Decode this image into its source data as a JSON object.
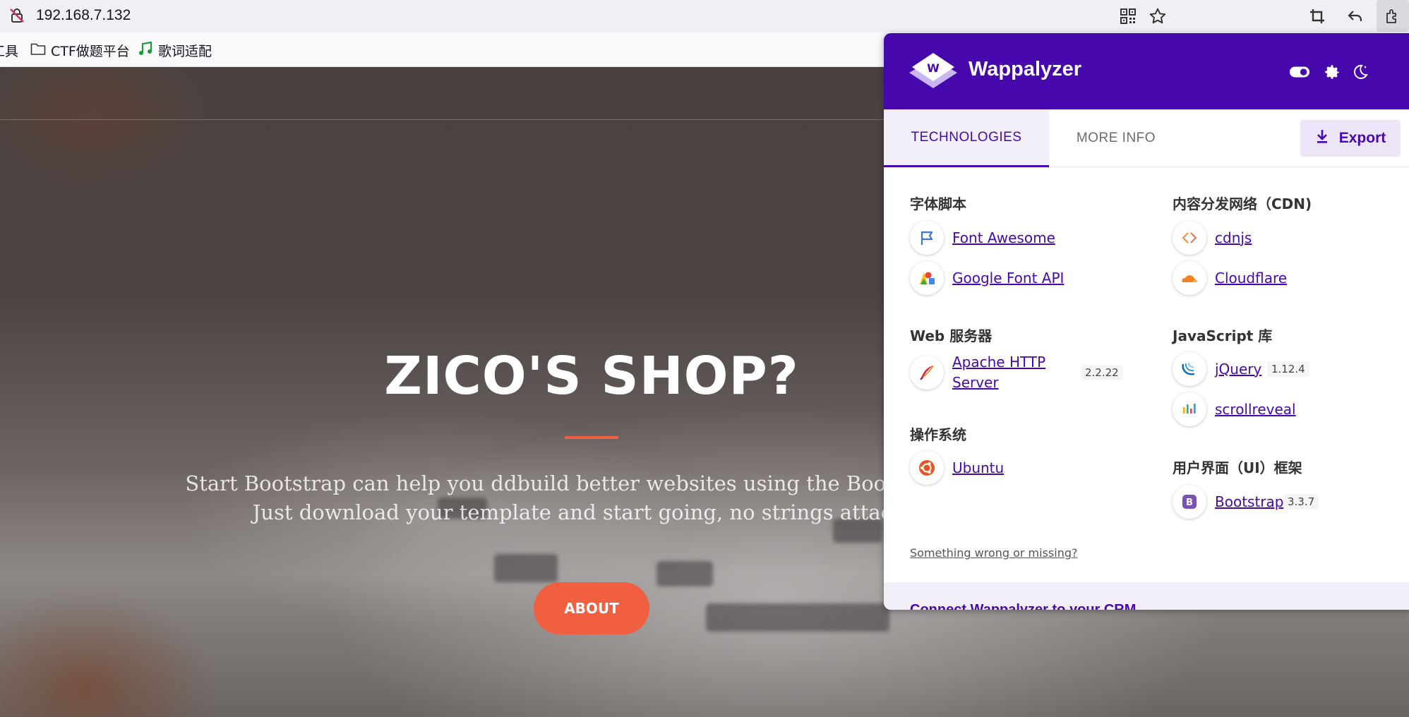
{
  "browser": {
    "url": "192.168.7.132",
    "bookmarks": [
      {
        "label": "工具",
        "icon": "partial-item"
      },
      {
        "label": "CTF做题平台",
        "icon": "folder-icon"
      },
      {
        "label": "歌词适配",
        "icon": "music-note-icon"
      }
    ]
  },
  "site": {
    "hero_title": "ZICO'S SHOP?",
    "hero_text_line1": "Start Bootstrap can help you ddbuild better websites using the Bootstrap CSS",
    "hero_text_line2": "Just download your template and start going, no strings attached",
    "about_label": "ABOUT",
    "accent_color": "#f05f40"
  },
  "wappalyzer": {
    "name": "Wappalyzer",
    "brand_color": "#4608ad",
    "tabs": {
      "technologies": "TECHNOLOGIES",
      "more_info": "MORE INFO"
    },
    "export_label": "Export",
    "categories": {
      "fonts": {
        "title": "字体脚本",
        "items": [
          {
            "name": "Font Awesome",
            "icon": "font-awesome-flag-icon"
          },
          {
            "name": "Google Font API",
            "icon": "google-fonts-icon"
          }
        ]
      },
      "webserver": {
        "title": "Web 服务器",
        "items": [
          {
            "name_line1": "Apache HTTP",
            "name_line2": "Server",
            "version": "2.2.22",
            "icon": "apache-feather-icon"
          }
        ]
      },
      "os": {
        "title": "操作系统",
        "items": [
          {
            "name": "Ubuntu",
            "icon": "ubuntu-icon"
          }
        ]
      },
      "cdn": {
        "title": "内容分发网络（CDN)",
        "items": [
          {
            "name": "cdnjs",
            "icon": "cdnjs-icon"
          },
          {
            "name": "Cloudflare",
            "icon": "cloudflare-icon"
          }
        ]
      },
      "jslib": {
        "title": "JavaScript 库",
        "items": [
          {
            "name": "jQuery",
            "version": "1.12.4",
            "icon": "jquery-icon"
          },
          {
            "name": "scrollreveal",
            "icon": "scrollreveal-icon"
          }
        ]
      },
      "ui": {
        "title": "用户界面（UI）框架",
        "items": [
          {
            "name": "Bootstrap",
            "version": "3.3.7",
            "icon": "bootstrap-icon"
          }
        ]
      }
    },
    "wrong_link": "Something wrong or missing?",
    "footer_text": "Connect Wappalyzer to your CRM"
  }
}
